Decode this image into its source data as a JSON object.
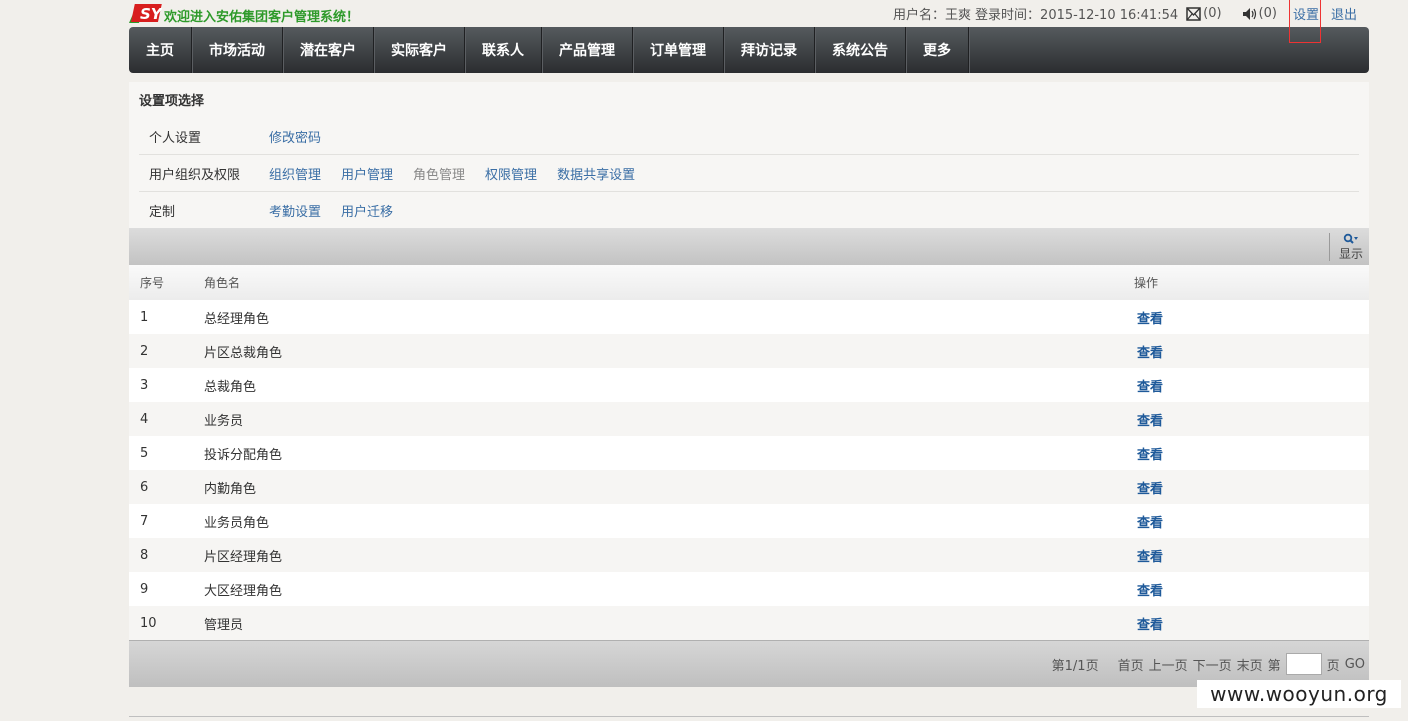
{
  "header": {
    "welcome": "欢迎进入安佑集团客户管理系统！",
    "user_label": "用户名：王爽",
    "login_label": "登录时间：2015-12-10 16:41:54",
    "mail_count": "(0)",
    "notice_count": "(0)",
    "settings_label": "设置",
    "logout_label": "退出",
    "logo_text": "SY"
  },
  "nav": {
    "items": [
      {
        "label": "主页"
      },
      {
        "label": "市场活动"
      },
      {
        "label": "潜在客户"
      },
      {
        "label": "实际客户"
      },
      {
        "label": "联系人"
      },
      {
        "label": "产品管理"
      },
      {
        "label": "订单管理"
      },
      {
        "label": "拜访记录"
      },
      {
        "label": "系统公告"
      },
      {
        "label": "更多"
      }
    ]
  },
  "settings_panel": {
    "title": "设置项选择",
    "rows": [
      {
        "label": "个人设置",
        "links": [
          "修改密码"
        ]
      },
      {
        "label": "用户组织及权限",
        "links": [
          "组织管理",
          "用户管理",
          "角色管理",
          "权限管理",
          "数据共享设置"
        ]
      },
      {
        "label": "定制",
        "links": [
          "考勤设置",
          "用户迁移"
        ]
      }
    ]
  },
  "toolbar": {
    "display_label": "显示"
  },
  "table": {
    "headers": {
      "no": "序号",
      "name": "角色名",
      "op": "操作"
    },
    "action_label": "查看",
    "rows": [
      {
        "no": "1",
        "name": "总经理角色"
      },
      {
        "no": "2",
        "name": "片区总裁角色"
      },
      {
        "no": "3",
        "name": "总裁角色"
      },
      {
        "no": "4",
        "name": "业务员"
      },
      {
        "no": "5",
        "name": "投诉分配角色"
      },
      {
        "no": "6",
        "name": "内勤角色"
      },
      {
        "no": "7",
        "name": "业务员角色"
      },
      {
        "no": "8",
        "name": "片区经理角色"
      },
      {
        "no": "9",
        "name": "大区经理角色"
      },
      {
        "no": "10",
        "name": "管理员"
      }
    ]
  },
  "pager": {
    "info": "第1/1页",
    "first": "首页",
    "prev": "上一页",
    "next": "下一页",
    "last": "末页",
    "page_prefix": "第",
    "page_suffix": "页",
    "go": "GO"
  },
  "watermark": "www.wooyun.org",
  "colors": {
    "accent_green": "#2e9a2a",
    "link_blue": "#3a6ea5",
    "nav_dark": "#2b2d30",
    "highlight_red": "#e33333"
  }
}
